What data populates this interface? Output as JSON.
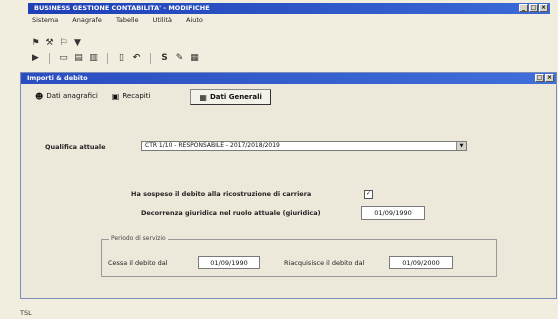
{
  "main_window": {
    "title": "BUSINESS GESTIONE CONTABILITA' - MODIFICHE",
    "buttons": [
      "_",
      "□",
      "×"
    ]
  },
  "menubar": {
    "items": [
      "Sistema",
      "Anagrafe",
      "Tabelle",
      "Utilità",
      "Aiuto"
    ]
  },
  "toolbar1": {
    "icons": [
      "tool-icon",
      "tool-icon",
      "tool-icon",
      "filter-icon"
    ]
  },
  "toolbar2": {
    "icons": [
      "tool-icon",
      "save-icon",
      "print-icon",
      "copy-icon",
      "clip-icon",
      "s-icon",
      "edit-icon",
      "grid-icon"
    ]
  },
  "child_window": {
    "title": "Importi & debito",
    "buttons": [
      "□",
      "×"
    ]
  },
  "tabs": [
    {
      "label": "Dati anagrafici",
      "icon": "user-icon"
    },
    {
      "label": "Recapiti",
      "icon": "book-icon"
    },
    {
      "label": "Dati Generali",
      "icon": "grid-icon"
    }
  ],
  "form": {
    "qualifica_label": "Qualifica attuale",
    "qualifica_value": "CTR 1/10 - RESPONSABILE - 2017/2018/2019",
    "sospeso_label": "Ha sospeso il debito alla ricostruzione di carriera",
    "sospeso_checked": true,
    "decorrenza_label": "Decorrenza giuridica nel ruolo attuale (giuridica)",
    "decorrenza_value": "01/09/1990",
    "group_title": "Periodo di servizio",
    "cessa_label": "Cessa il debito dal",
    "cessa_value": "01/09/1990",
    "riacquisisce_label": "Riacquisisce il debito dal",
    "riacquisisce_value": "01/09/2000"
  },
  "statusbar": {
    "text": "TSL"
  }
}
